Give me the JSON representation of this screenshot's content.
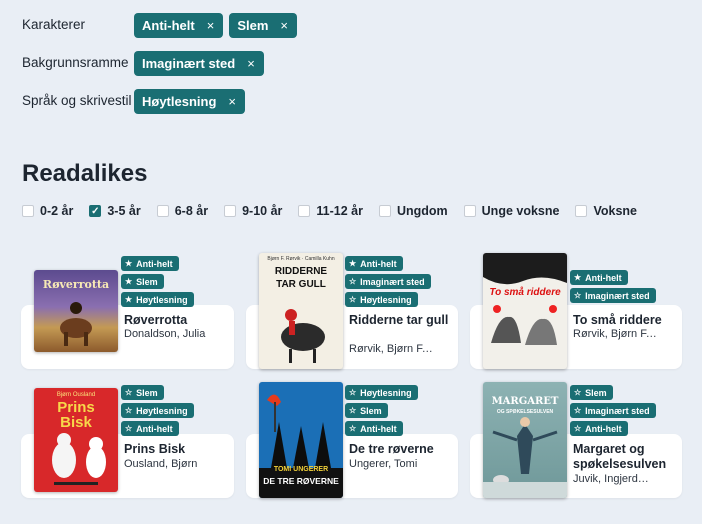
{
  "filters": [
    {
      "label": "Karakterer",
      "chips": [
        "Anti-helt",
        "Slem"
      ]
    },
    {
      "label": "Bakgrunnsramme",
      "chips": [
        "Imaginært sted"
      ]
    },
    {
      "label": "Språk og skrivestil",
      "chips": [
        "Høytlesning"
      ]
    }
  ],
  "chip_remove": "×",
  "section_title": "Readalikes",
  "ages": [
    {
      "label": "0-2 år",
      "checked": false
    },
    {
      "label": "3-5 år",
      "checked": true
    },
    {
      "label": "6-8 år",
      "checked": false
    },
    {
      "label": "9-10 år",
      "checked": false
    },
    {
      "label": "11-12 år",
      "checked": false
    },
    {
      "label": "Ungdom",
      "checked": false
    },
    {
      "label": "Unge voksne",
      "checked": false
    },
    {
      "label": "Voksne",
      "checked": false
    }
  ],
  "books": [
    {
      "title": "Røverrotta",
      "author": "Donaldson, Julia",
      "tags": [
        {
          "label": "Anti-helt",
          "icon": "star-solid"
        },
        {
          "label": "Slem",
          "icon": "star-solid"
        },
        {
          "label": "Høytlesning",
          "icon": "star-solid"
        }
      ],
      "cover_text": "Røverrotta",
      "cover_color": "#7a5a9a"
    },
    {
      "title": "Ridderne tar gull",
      "author": "Rørvik, Bjørn F....",
      "tags": [
        {
          "label": "Anti-helt",
          "icon": "star-solid"
        },
        {
          "label": "Imaginært sted",
          "icon": "star-outline"
        },
        {
          "label": "Høytlesning",
          "icon": "star-outline"
        }
      ],
      "cover_text": "RIDDERNE TAR GULL",
      "cover_author_line": "Bjørn F. Rørvik · Camilla Kuhn",
      "cover_color": "#f3efe4"
    },
    {
      "title": "To små riddere",
      "author": "Rørvik, Bjørn F....",
      "tags": [
        {
          "label": "Anti-helt",
          "icon": "star-solid"
        },
        {
          "label": "Imaginært sted",
          "icon": "star-outline"
        }
      ],
      "cover_text": "To små riddere",
      "cover_color": "#f2f0ea"
    },
    {
      "title": "Prins Bisk",
      "author": "Ousland, Bjørn",
      "tags": [
        {
          "label": "Slem",
          "icon": "star-outline"
        },
        {
          "label": "Høytlesning",
          "icon": "star-outline"
        },
        {
          "label": "Anti-helt",
          "icon": "star-outline"
        }
      ],
      "cover_text": "Prins Bisk",
      "cover_author_line": "Bjørn Ousland",
      "cover_color": "#d8282a"
    },
    {
      "title": "De tre røverne",
      "author": "Ungerer, Tomi",
      "tags": [
        {
          "label": "Høytlesning",
          "icon": "star-outline"
        },
        {
          "label": "Slem",
          "icon": "star-outline"
        },
        {
          "label": "Anti-helt",
          "icon": "star-outline"
        }
      ],
      "cover_text": "DE TRE RØVERNE",
      "cover_author_line": "TOMI UNGERER",
      "cover_color": "#1b6fb6"
    },
    {
      "title": "Margaret og spøkelsesulven",
      "author": "Juvik, Ingjerd…",
      "tags": [
        {
          "label": "Slem",
          "icon": "star-outline"
        },
        {
          "label": "Imaginært sted",
          "icon": "star-outline"
        },
        {
          "label": "Anti-helt",
          "icon": "star-outline"
        }
      ],
      "cover_text": "MARGARET",
      "cover_subtext": "OG SPØKELSESULVEN",
      "cover_color": "#7fa7a8"
    }
  ]
}
